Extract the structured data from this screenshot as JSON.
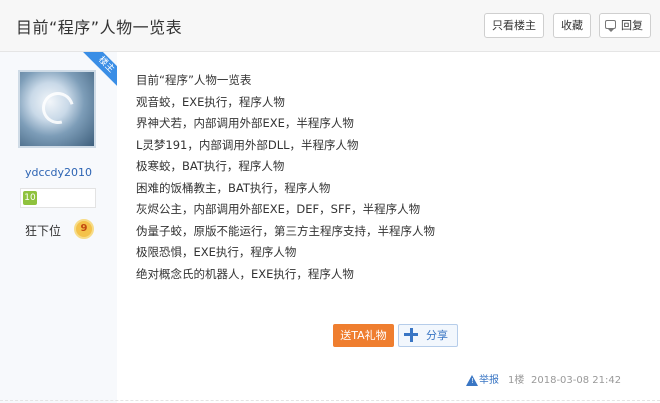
{
  "header": {
    "title": "目前“程序”人物一览表",
    "only_op_label": "只看楼主",
    "favorite_label": "收藏",
    "reply_label": "回复"
  },
  "user": {
    "op_ribbon": "楼主",
    "username": "ydccdy2010",
    "level": "10",
    "rank_title": "狂下位",
    "rank_badge": "9"
  },
  "post": {
    "lines": [
      "目前“程序”人物一览表",
      "观音蛟，EXE执行，程序人物",
      "界神犬若，内部调用外部EXE，半程序人物",
      "L灵梦191，内部调用外部DLL，半程序人物",
      "极寒蛟，BAT执行，程序人物",
      "困难的饭桶教主，BAT执行，程序人物",
      "灰烬公主，内部调用外部EXE，DEF，SFF，半程序人物",
      "伪量子蛟，原版不能运行，第三方主程序支持，半程序人物",
      "极限恐惧，EXE执行，程序人物",
      "绝对概念氏的机器人，EXE执行，程序人物"
    ],
    "gift_label": "送TA礼物",
    "share_label": "分享"
  },
  "footer": {
    "report_label": "举报",
    "floor": "1楼",
    "time": "2018-03-08 21:42"
  },
  "colors": {
    "accent_blue": "#3a8ee6",
    "gift_orange": "#ef7e2f",
    "username_blue": "#2d64b3"
  }
}
